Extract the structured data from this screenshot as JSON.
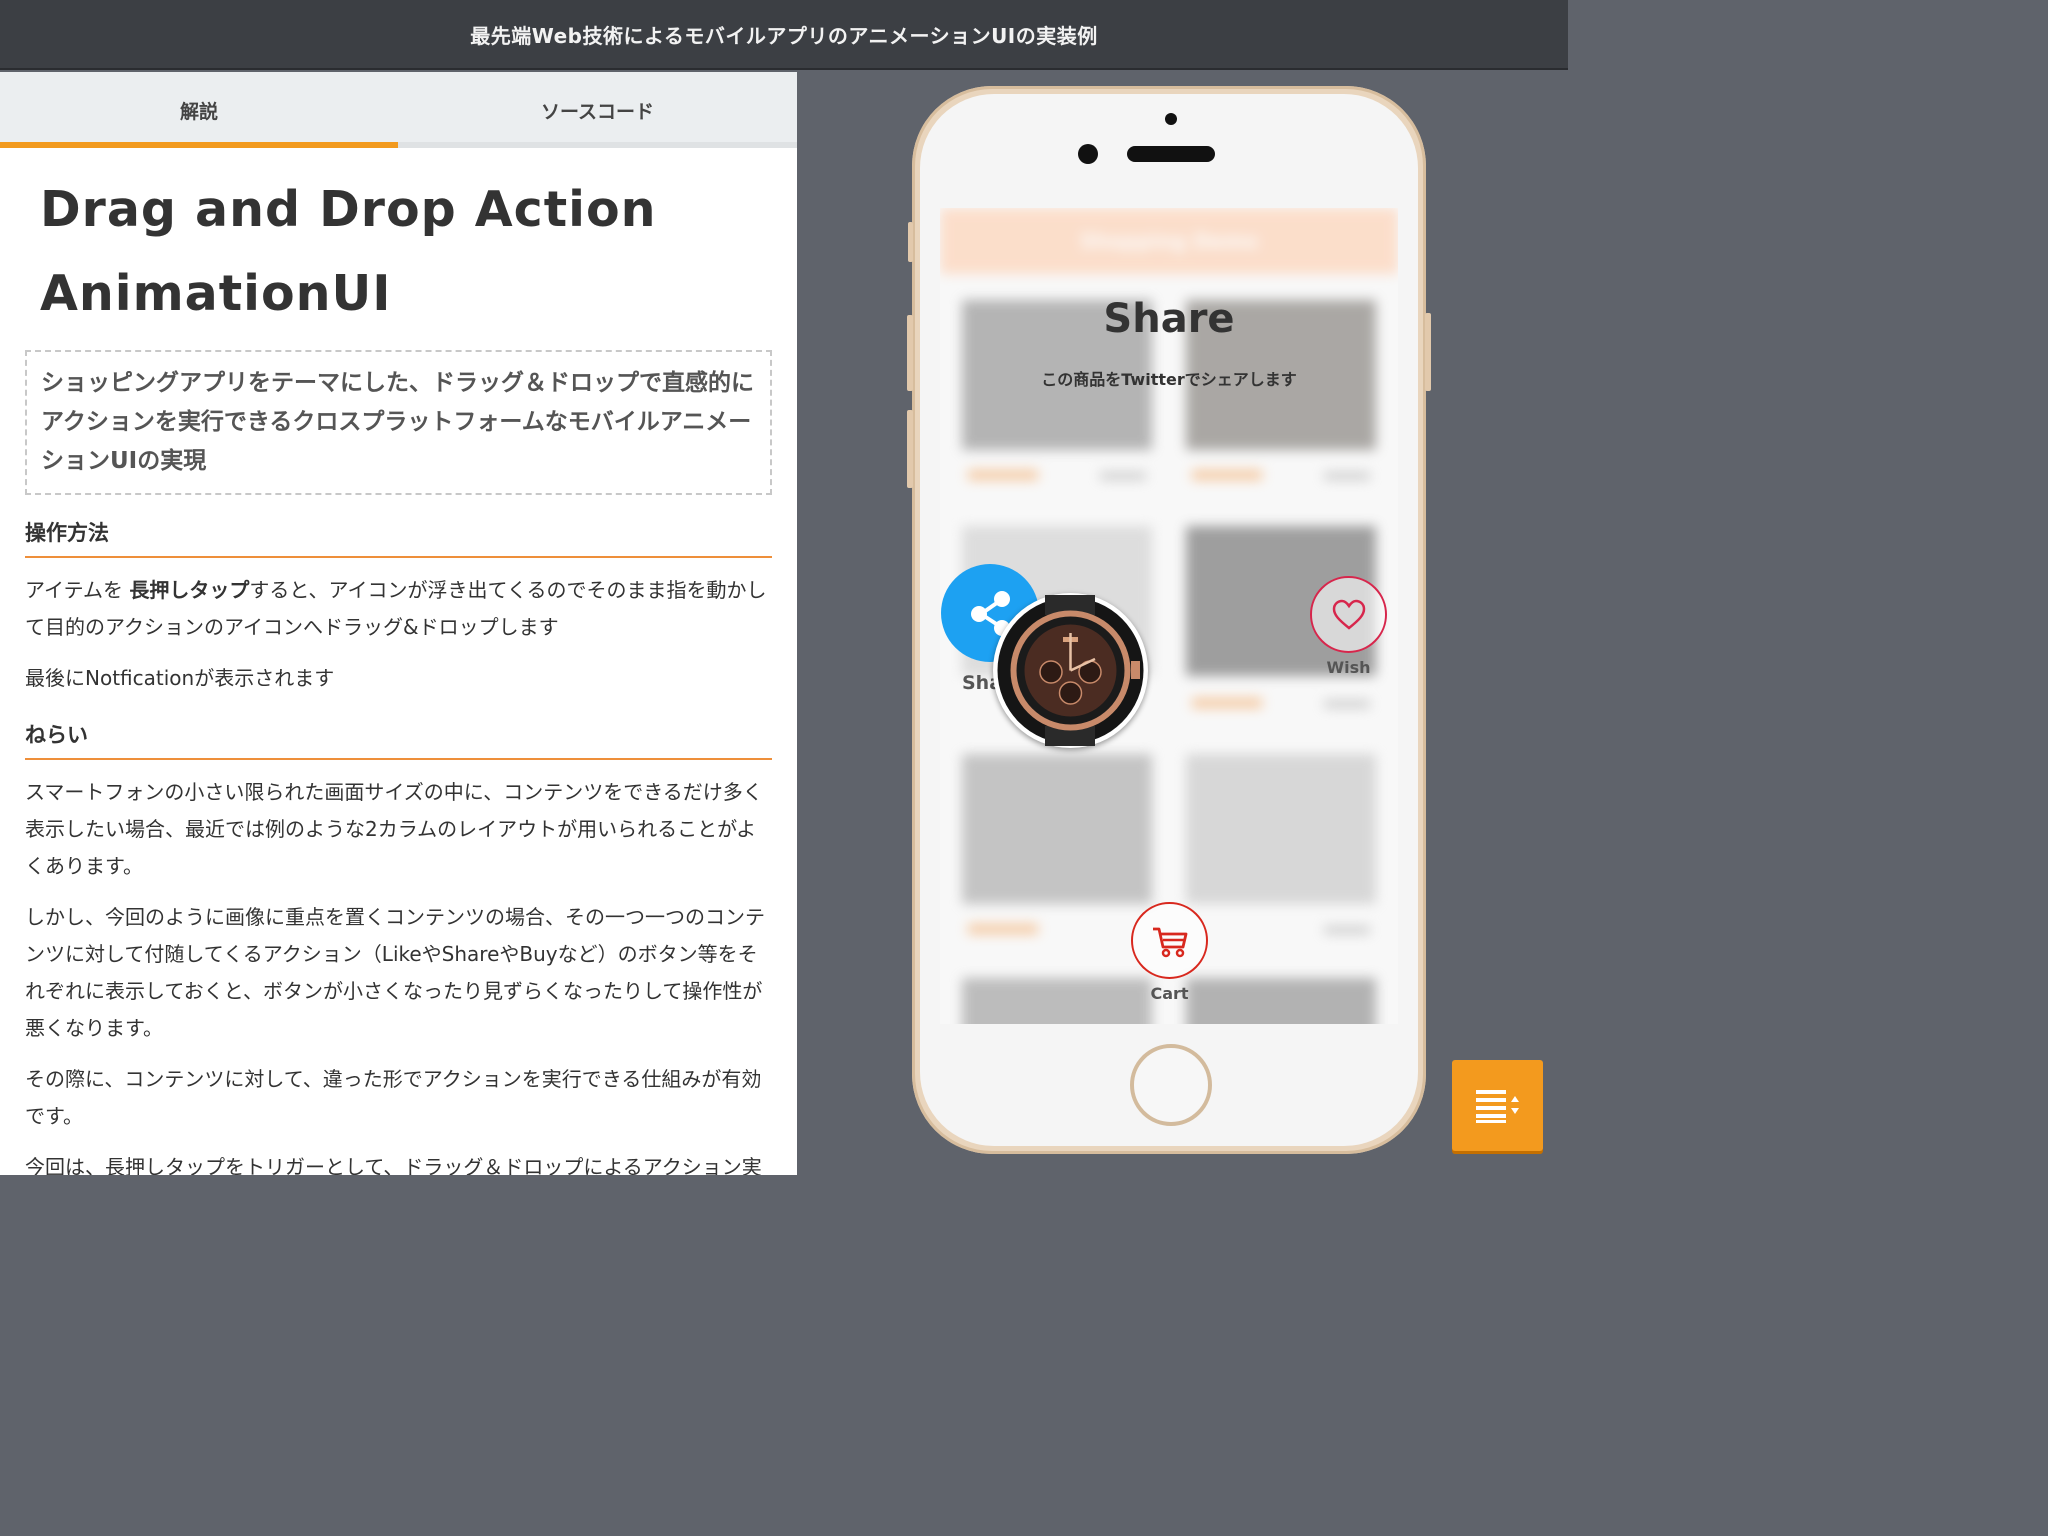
{
  "header": {
    "title": "最先端Web技術によるモバイルアプリのアニメーションUIの実装例"
  },
  "tabs": [
    {
      "label": "解説",
      "active": true
    },
    {
      "label": "ソースコード",
      "active": false
    }
  ],
  "article": {
    "title_line1": "Drag and Drop Action",
    "title_line2": "AnimationUI",
    "lead": "ショッピングアプリをテーマにした、ドラッグ＆ドロップで直感的にアクションを実行できるクロスプラットフォームなモバイルアニメーションUIの実現",
    "section1": {
      "heading": "操作方法",
      "p1_before": "アイテムを ",
      "p1_bold": "長押しタップ",
      "p1_after": "すると、アイコンが浮き出てくるのでそのまま指を動かして目的のアクションのアイコンへドラッグ&ドロップします",
      "p2": "最後にNotficationが表示されます"
    },
    "section2": {
      "heading": "ねらい",
      "p1": "スマートフォンの小さい限られた画面サイズの中に、コンテンツをできるだけ多く表示したい場合、最近では例のような2カラムのレイアウトが用いられることがよくあります。",
      "p2": "しかし、今回のように画像に重点を置くコンテンツの場合、その一つ一つのコンテンツに対して付随してくるアクション（LikeやShareやBuyなど）のボタン等をそれぞれに表示しておくと、ボタンが小さくなったり見ずらくなったりして操作性が悪くなります。",
      "p3": "その際に、コンテンツに対して、違った形でアクションを実行できる仕組みが有効です。",
      "p4": "今回は、長押しタップをトリガーとして、ドラッグ＆ドロップによるアクション実行という直感的でかつ、気持ちの良いインタ―フェイスを実現しまし"
    }
  },
  "phone": {
    "app_header": "Shopping Demo",
    "overlay_title": "Share",
    "overlay_subtitle": "この商品をTwitterでシェアします",
    "actions": {
      "share_label": "Sha",
      "wish_label": "Wish",
      "cart_label": "Cart"
    }
  },
  "colors": {
    "accent": "#f29a1e",
    "twitter_blue": "#1da1f2",
    "wish_red": "#d7264c",
    "cart_red": "#d8281e"
  }
}
